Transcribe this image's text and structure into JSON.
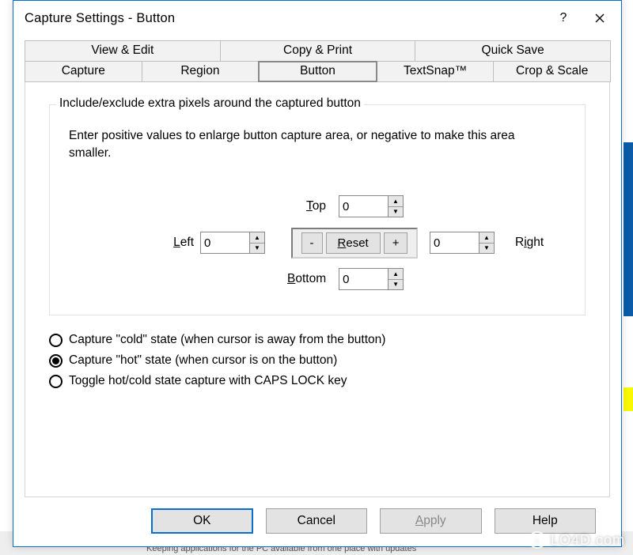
{
  "window": {
    "title": "Capture Settings -  Button"
  },
  "tabs": {
    "row1": [
      "View & Edit",
      "Copy & Print",
      "Quick Save"
    ],
    "row2": [
      "Capture",
      "Region",
      "Button",
      "TextSnap™",
      "Crop & Scale"
    ],
    "active": "Button"
  },
  "group": {
    "legend": "Include/exclude extra pixels around the captured button",
    "description": "Enter positive values to enlarge button capture area, or negative to make this area smaller.",
    "labels": {
      "top": "Top",
      "left": "Left",
      "right": "Right",
      "bottom": "Bottom"
    },
    "values": {
      "top": "0",
      "left": "0",
      "right": "0",
      "bottom": "0"
    },
    "reset": {
      "minus": "-",
      "reset": "Reset",
      "plus": "+"
    }
  },
  "radios": {
    "options": [
      "Capture \"cold\" state (when cursor is away from the button)",
      "Capture \"hot\" state (when cursor is on the button)",
      "Toggle hot/cold state capture with CAPS LOCK key"
    ],
    "selected": 1
  },
  "footer": {
    "ok": "OK",
    "cancel": "Cancel",
    "apply": "Apply",
    "help": "Help"
  },
  "watermark": "LO4D.com",
  "bg_text": "Keeping applications for the PC available from one place with updates"
}
